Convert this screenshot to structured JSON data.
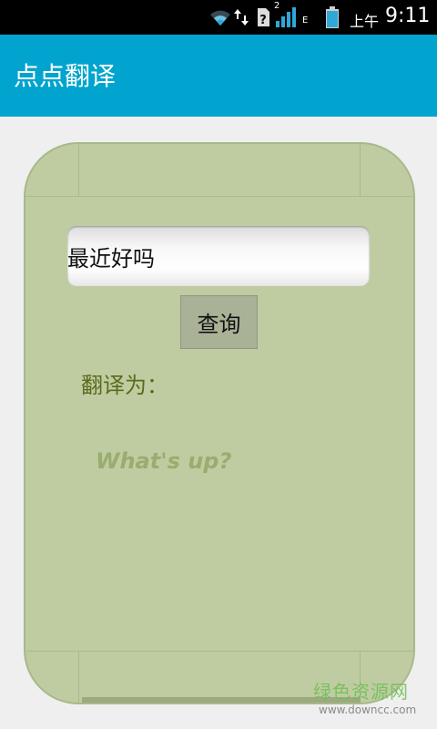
{
  "status_bar": {
    "am_pm": "上午",
    "time": "9:11",
    "sim_superscript": "2",
    "network_type": "E",
    "icons": [
      "wifi-icon",
      "data-arrows-icon",
      "sim-unknown-icon",
      "signal-icon",
      "battery-icon"
    ]
  },
  "action_bar": {
    "title": "点点翻译",
    "color": "#00a4cf"
  },
  "translator": {
    "input_value": "最近好吗",
    "query_button": "查询",
    "result_label": "翻译为：",
    "result_text": "What's up?",
    "card_color": "#bfcca2"
  },
  "watermark": {
    "text": "绿色资源网",
    "url": "www.downcc.com"
  }
}
